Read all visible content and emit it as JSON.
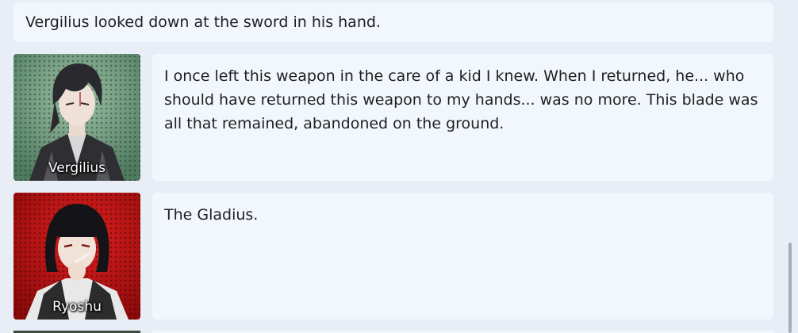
{
  "narration": "Vergilius looked down at the sword in his hand.",
  "entries": [
    {
      "speaker": "Vergilius",
      "text": "I once left this weapon in the care of a kid I knew. When I returned, he... who should have returned this weapon to my hands... was no more. This blade was all that remained, abandoned on the ground."
    },
    {
      "speaker": "Ryoshu",
      "text": "The Gladius."
    }
  ],
  "colors": {
    "page_background": "#e9eef6",
    "bubble_background": "#f2f6fd",
    "text": "#1f1f1f"
  }
}
